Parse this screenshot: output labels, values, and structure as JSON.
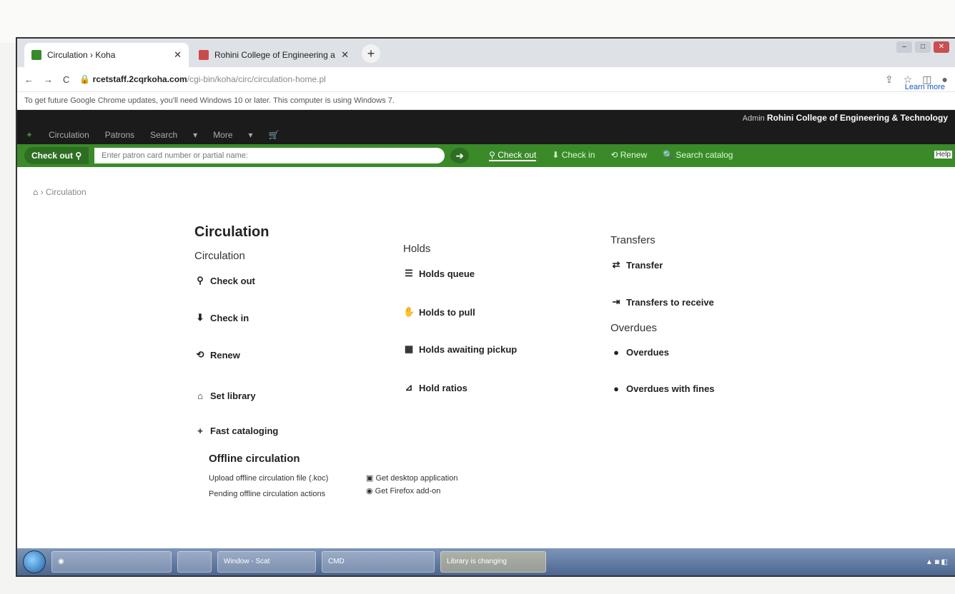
{
  "browser": {
    "tabs": [
      {
        "title": "Circulation › Koha",
        "active": true
      },
      {
        "title": "Rohini College of Engineering a",
        "active": false
      }
    ],
    "address": {
      "host": "rcetstaff.2cqrkoha.com",
      "path": "/cgi-bin/koha/circ/circulation-home.pl"
    },
    "learn_more": "Learn more",
    "info_bar": "To get future Google Chrome updates, you'll need Windows 10 or later. This computer is using Windows 7."
  },
  "koha": {
    "user_label": "Admin",
    "library": "Rohini College of Engineering & Technology",
    "nav": [
      "Circulation",
      "Patrons",
      "Search",
      "More",
      ""
    ],
    "checkout_button": "Check out",
    "search_placeholder": "Enter patron card number or partial name:",
    "quick_links": [
      "Check out",
      "Check in",
      "Renew",
      "Search catalog"
    ],
    "help": "Help"
  },
  "breadcrumb": "Circulation",
  "page_title": "Circulation",
  "circulation": {
    "heading": "Circulation",
    "items": [
      {
        "icon": "user-icon",
        "label": "Check out"
      },
      {
        "icon": "download-icon",
        "label": "Check in"
      },
      {
        "icon": "refresh-icon",
        "label": "Renew"
      },
      {
        "icon": "home-icon",
        "label": "Set library"
      },
      {
        "icon": "plus-icon",
        "label": "Fast cataloging"
      }
    ]
  },
  "holds": {
    "heading": "Holds",
    "items": [
      {
        "icon": "list-icon",
        "label": "Holds queue"
      },
      {
        "icon": "hand-icon",
        "label": "Holds to pull"
      },
      {
        "icon": "calendar-icon",
        "label": "Holds awaiting pickup"
      },
      {
        "icon": "chart-icon",
        "label": "Hold ratios"
      }
    ]
  },
  "transfers": {
    "heading": "Transfers",
    "items": [
      {
        "icon": "transfer-icon",
        "label": "Transfer"
      },
      {
        "icon": "receive-icon",
        "label": "Transfers to receive"
      }
    ]
  },
  "overdues": {
    "heading": "Overdues",
    "items": [
      {
        "icon": "warning-icon",
        "label": "Overdues"
      },
      {
        "icon": "warning-icon",
        "label": "Overdues with fines"
      }
    ]
  },
  "offline": {
    "heading": "Offline circulation",
    "upload": "Upload offline circulation file (.koc)",
    "pending": "Pending offline circulation actions",
    "desktop": "Get desktop application",
    "firefox": "Get Firefox add-on"
  },
  "taskbar": {
    "tasks": [
      "",
      "",
      "Window - Scat",
      "CMD",
      "Library is changing"
    ]
  }
}
